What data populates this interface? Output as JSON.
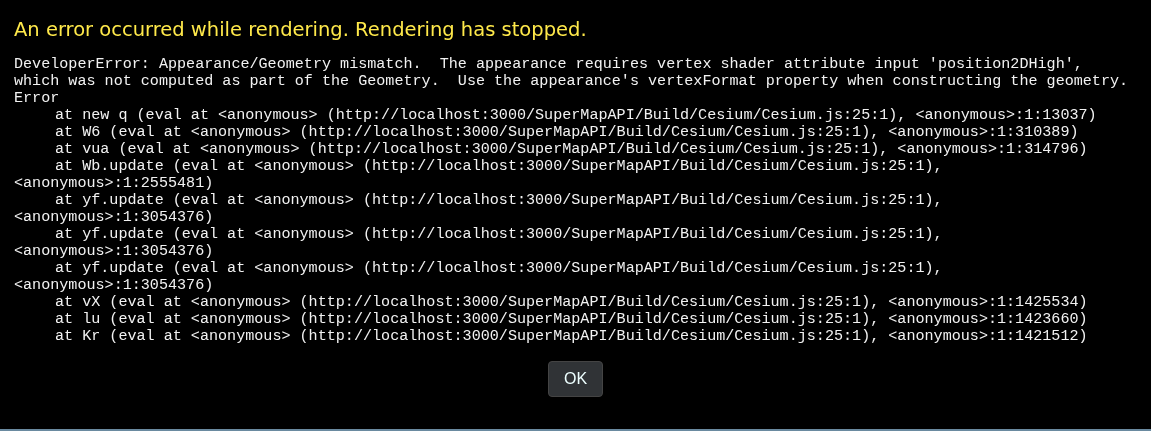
{
  "dialog": {
    "title": "An error occurred while rendering. Rendering has stopped.",
    "message_lines": [
      "DeveloperError: Appearance/Geometry mismatch.  The appearance requires vertex shader attribute input 'position2DHigh',",
      "which was not computed as part of the Geometry.  Use the appearance's vertexFormat property when constructing the geometry.",
      "Error"
    ],
    "stack_frames": [
      {
        "text": "at new q (eval at <anonymous> (http://localhost:3000/SuperMapAPI/Build/Cesium/Cesium.js:25:1), <anonymous>:1:13037)"
      },
      {
        "text": "at W6 (eval at <anonymous> (http://localhost:3000/SuperMapAPI/Build/Cesium/Cesium.js:25:1), <anonymous>:1:310389)"
      },
      {
        "text": "at vua (eval at <anonymous> (http://localhost:3000/SuperMapAPI/Build/Cesium/Cesium.js:25:1), <anonymous>:1:314796)"
      },
      {
        "text": "at Wb.update (eval at <anonymous> (http://localhost:3000/SuperMapAPI/Build/Cesium/Cesium.js:25:1),",
        "continuation": "<anonymous>:1:2555481)"
      },
      {
        "text": "at yf.update (eval at <anonymous> (http://localhost:3000/SuperMapAPI/Build/Cesium/Cesium.js:25:1),",
        "continuation": "<anonymous>:1:3054376)"
      },
      {
        "text": "at yf.update (eval at <anonymous> (http://localhost:3000/SuperMapAPI/Build/Cesium/Cesium.js:25:1),",
        "continuation": "<anonymous>:1:3054376)"
      },
      {
        "text": "at yf.update (eval at <anonymous> (http://localhost:3000/SuperMapAPI/Build/Cesium/Cesium.js:25:1),",
        "continuation": "<anonymous>:1:3054376)"
      },
      {
        "text": "at vX (eval at <anonymous> (http://localhost:3000/SuperMapAPI/Build/Cesium/Cesium.js:25:1), <anonymous>:1:1425534)"
      },
      {
        "text": "at lu (eval at <anonymous> (http://localhost:3000/SuperMapAPI/Build/Cesium/Cesium.js:25:1), <anonymous>:1:1423660)"
      },
      {
        "text": "at Kr (eval at <anonymous> (http://localhost:3000/SuperMapAPI/Build/Cesium/Cesium.js:25:1), <anonymous>:1:1421512)"
      }
    ],
    "button": "OK"
  }
}
